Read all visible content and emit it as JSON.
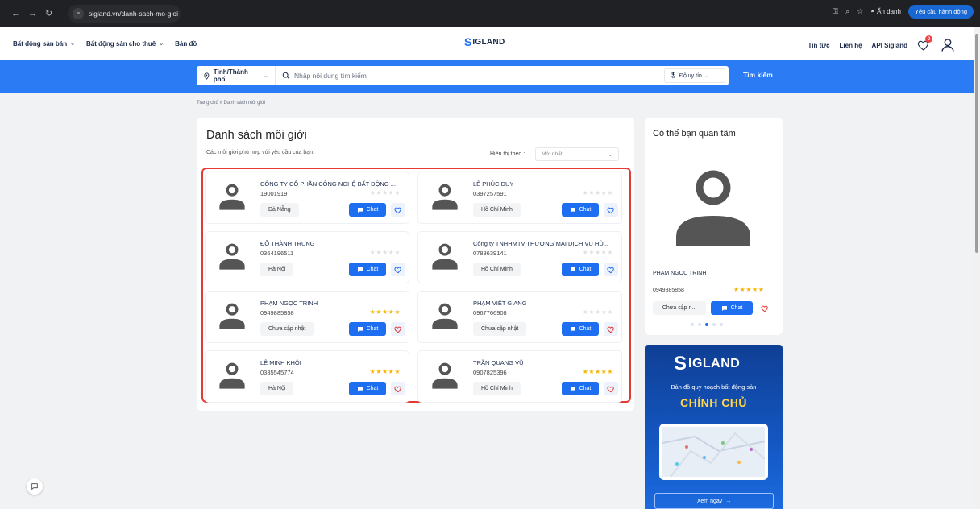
{
  "browser": {
    "url": "sigland.vn/danh-sach-mo-gioi",
    "incognito_label": "Ẩn danh",
    "action_button": "Yêu cầu hành động"
  },
  "header": {
    "menu": [
      {
        "label": "Bất động sản bán",
        "has_dropdown": true
      },
      {
        "label": "Bất động sản cho thuê",
        "has_dropdown": true
      },
      {
        "label": "Bản đồ",
        "has_dropdown": false
      }
    ],
    "logo_s": "S",
    "logo_text": "IGLAND",
    "right_links": [
      "Tin tức",
      "Liên hệ",
      "API Sigland"
    ],
    "favorites_count": "0"
  },
  "search": {
    "province_label": "Tỉnh/Thành phố",
    "placeholder": "Nhập nội dung tìm kiếm",
    "reliability_label": "Độ uy tín",
    "button": "Tìm kiếm"
  },
  "breadcrumb": {
    "home": "Trang chủ",
    "separator": "»",
    "current": "Danh sách môi giới"
  },
  "main": {
    "title": "Danh sách môi giới",
    "subtitle": "Các môi giới phù hợp với yêu cầu của bạn.",
    "sort_label": "Hiển thị theo :",
    "sort_value": "Mới nhất",
    "chat_label": "Chat",
    "agents": [
      {
        "name": "CÔNG TY CỔ PHẦN CÔNG NGHỆ BẤT ĐỘNG ...",
        "phone": "19001919",
        "location": "Đà Nẵng",
        "rating": 0,
        "favorited": false
      },
      {
        "name": "LÊ PHÚC DUY",
        "phone": "0397257591",
        "location": "Hồ Chí Minh",
        "rating": 0,
        "favorited": false
      },
      {
        "name": "ĐỖ THÀNH TRUNG",
        "phone": "0364196511",
        "location": "Hà Nội",
        "rating": 0,
        "favorited": false
      },
      {
        "name": "Công ty TNHHMTV THƯƠNG MẠI DỊCH VỤ HÙ...",
        "phone": "0788639141",
        "location": "Hồ Chí Minh",
        "rating": 0,
        "favorited": false
      },
      {
        "name": "PHẠM NGỌC TRINH",
        "phone": "0949885858",
        "location": "Chưa cập nhật",
        "rating": 4.5,
        "favorited": true
      },
      {
        "name": "PHẠM VIỆT GIANG",
        "phone": "0967766908",
        "location": "Chưa cập nhật",
        "rating": 0,
        "favorited": true
      },
      {
        "name": "LÊ MINH KHÔI",
        "phone": "0335545774",
        "location": "Hà Nội",
        "rating": 5,
        "favorited": true
      },
      {
        "name": "TRẦN QUANG VŨ",
        "phone": "0907825396",
        "location": "Hồ Chí Minh",
        "rating": 5,
        "favorited": true
      }
    ]
  },
  "sidebar": {
    "title": "Có thể bạn quan tâm",
    "agent_name": "PHẠM NGỌC TRINH",
    "agent_phone": "0949885858",
    "agent_location": "Chưa cập n...",
    "agent_rating": 4.5,
    "chat_label": "Chat",
    "carousel_active": 2,
    "carousel_count": 5
  },
  "banner": {
    "logo_s": "S",
    "logo_text": "IGLAND",
    "tagline": "Bản đồ quy hoạch bất động sản",
    "headline": "CHÍNH CHỦ",
    "cta": "Xem ngay",
    "cta_arrow": "→"
  },
  "colors": {
    "brand_blue": "#2b7bf4",
    "chat_blue": "#1e6ef2",
    "star_gold": "#f4b400",
    "highlight_red": "#e53935"
  }
}
